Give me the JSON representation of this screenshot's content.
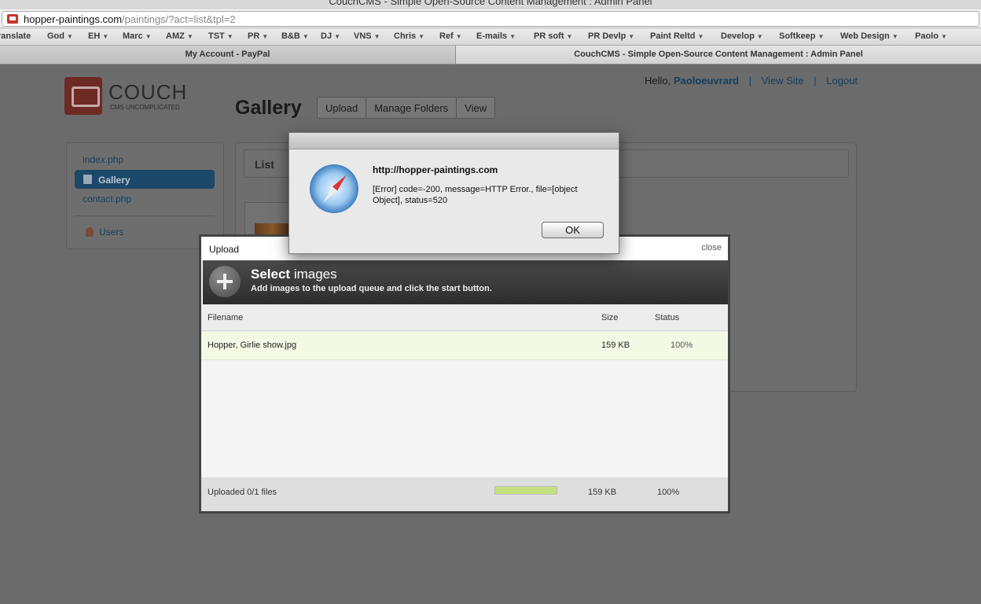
{
  "browser": {
    "title": "CouchCMS - Simple Open-Source Content Management : Admin Panel",
    "url_host": "hopper-paintings.com",
    "url_path": "/paintings/?act=list&tpl=2",
    "bookmarks": [
      "ranslate",
      "God",
      "EH",
      "Marc",
      "AMZ",
      "TST",
      "PR",
      "B&B",
      "DJ",
      "VNS",
      "Chris",
      "Ref",
      "E-mails",
      "PR soft",
      "PR Devlp",
      "Paint Reltd",
      "Develop",
      "Softkeep",
      "Web Design",
      "Paolo"
    ],
    "tabs": [
      "My Account - PayPal",
      "CouchCMS - Simple Open-Source Content Management : Admin Panel"
    ]
  },
  "header": {
    "logo_word": "COUCH",
    "logo_sub": "CMS UNCOMPLICATED",
    "hello": "Hello,",
    "username": "Paoloeuvrard",
    "view_site": "View Site",
    "logout": "Logout",
    "separator": "|"
  },
  "page": {
    "title": "Gallery",
    "tabs": [
      "Upload",
      "Manage Folders",
      "View"
    ]
  },
  "sidebar": {
    "items": [
      "index.php",
      "Gallery",
      "contact.php"
    ],
    "users": "Users"
  },
  "main": {
    "list_title": "List"
  },
  "upload": {
    "title": "Upload",
    "close": "close",
    "heading_prefix": "Select",
    "heading_rest": " images",
    "description": "Add images to the upload queue and click the start button.",
    "columns": {
      "filename": "Filename",
      "size": "Size",
      "status": "Status"
    },
    "files": [
      {
        "name": "Hopper, Girlie show.jpg",
        "size": "159 KB",
        "status": "100%"
      }
    ],
    "footer": {
      "summary": "Uploaded 0/1 files",
      "size": "159 KB",
      "status": "100%",
      "progress": 1.0
    }
  },
  "alert": {
    "source": "http://hopper-paintings.com",
    "message": "[Error]  code=-200, message=HTTP Error., file=[object Object], status=520",
    "ok": "OK"
  }
}
